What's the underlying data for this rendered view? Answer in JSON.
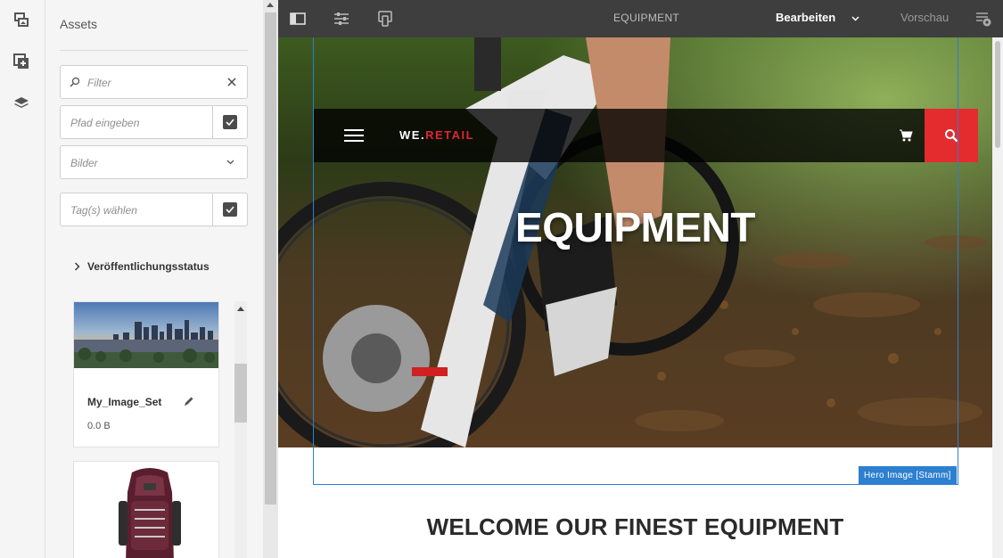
{
  "rail": {
    "icons": [
      "assets-icon",
      "components-icon",
      "content-tree-icon"
    ]
  },
  "panel": {
    "title": "Assets",
    "filter_placeholder": "Filter",
    "path_placeholder": "Pfad eingeben",
    "type_select_value": "Bilder",
    "tags_placeholder": "Tag(s) wählen",
    "publication_status_label": "Veröffentlichungsstatus",
    "cards": [
      {
        "title": "My_Image_Set",
        "size": "0.0 B"
      },
      {
        "title": "",
        "size": ""
      }
    ]
  },
  "toolbar": {
    "page_title": "EQUIPMENT",
    "mode_label": "Bearbeiten",
    "preview_label": "Vorschau"
  },
  "page": {
    "brand_part1": "WE.",
    "brand_part2": "RETAIL",
    "hero_title": "EQUIPMENT",
    "selection_label": "Hero Image [Stamm]",
    "welcome_heading": "WELCOME OUR FINEST EQUIPMENT"
  },
  "colors": {
    "accent_red": "#e42c2f",
    "selection_blue": "#2d7fd0",
    "toolbar_bg": "#3e3e3e"
  }
}
